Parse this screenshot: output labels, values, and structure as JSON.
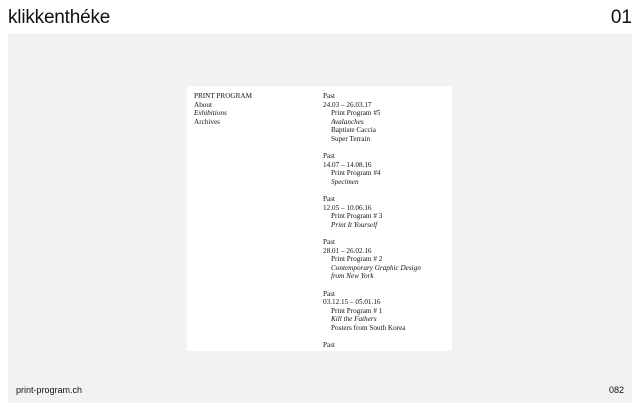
{
  "header": {
    "brand": "klikkenthéke",
    "slide_number": "01"
  },
  "preview": {
    "nav": [
      {
        "label": "PRINT PROGRAM",
        "italic": false
      },
      {
        "label": "About",
        "italic": false
      },
      {
        "label": "Exhibitions",
        "italic": true
      },
      {
        "label": "Archives",
        "italic": false
      }
    ],
    "exhibitions": [
      {
        "status": "Past",
        "dates": "24.03 – 26.03.17",
        "lines": [
          {
            "text": "Print Program #5",
            "italic": false
          },
          {
            "text": "Avalanches",
            "italic": true
          },
          {
            "text": "Baptiste Caccia",
            "italic": false
          },
          {
            "text": "Super Terrain",
            "italic": false
          }
        ]
      },
      {
        "status": "Past",
        "dates": "14.07 – 14.08.16",
        "lines": [
          {
            "text": "Print Program #4",
            "italic": false
          },
          {
            "text": "Specimen",
            "italic": true
          }
        ]
      },
      {
        "status": "Past",
        "dates": "12.05 – 10.06.16",
        "lines": [
          {
            "text": "Print Program # 3",
            "italic": false
          },
          {
            "text": "Print It Yourself",
            "italic": true
          }
        ]
      },
      {
        "status": "Past",
        "dates": "28.01 – 26.02.16",
        "lines": [
          {
            "text": "Print Program # 2",
            "italic": false
          },
          {
            "text": "Contemporary Graphic Design",
            "italic": true
          },
          {
            "text": "from New York",
            "italic": true
          }
        ]
      },
      {
        "status": "Past",
        "dates": "03.12.15 – 05.01.16",
        "lines": [
          {
            "text": "Print Program # 1",
            "italic": false
          },
          {
            "text": "Kill the Fathers",
            "italic": true
          },
          {
            "text": "Posters from South Korea",
            "italic": false
          }
        ]
      },
      {
        "status": "Past",
        "dates": "",
        "lines": []
      }
    ]
  },
  "footer": {
    "url": "print-program.ch",
    "page": "082"
  }
}
